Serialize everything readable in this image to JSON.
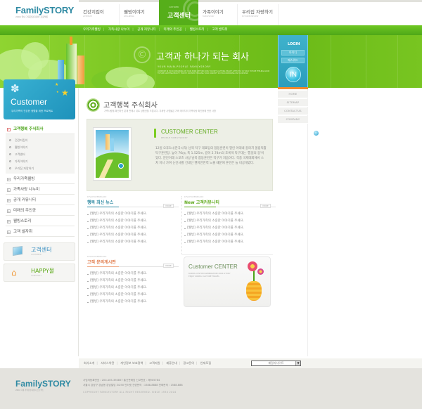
{
  "header": {
    "logo": "FamilySTORY",
    "logo_tagline": "2004 국내 가족건강지킴이 프로젝트",
    "gnb": [
      {
        "label": "건강지킴이",
        "sub": "LIFEHELTH"
      },
      {
        "label": "웰빙이야기",
        "sub": "WELLBEING"
      },
      {
        "label": "고객센터",
        "sub": "CUSTOMER",
        "active": true
      },
      {
        "label": "가족이야기",
        "sub": "FAMILYSTORY"
      },
      {
        "label": "우리집 자랑하기",
        "sub": "MYHOME PREVIEW"
      }
    ]
  },
  "subnav": [
    "우리가족웰빙",
    "가족사랑 나누미",
    "공개 커뮤니티",
    "미래의 주인공",
    "웰빙스토리",
    "고객 발자취"
  ],
  "banner": {
    "title": "고객과 하나가 되는 회사",
    "copyright_glyph": "©",
    "subtitle": "YOUR MAIN-PEOPLE FAMILYSRORY",
    "desc": "COMPOSE IN YOUR DREAMING ON YOUR MIND WE FIND IDEA FOR NET LIGHTING HEALTH LIFESTYLE IN YOUR FUTURE FEELING GOOD FUTURE LIGHTING BEAUTY FOR MY COUNTRY HEALING YOUR CONCEPT IN YOUR DREAMING ON YOUR MIND"
  },
  "login": {
    "title": "LOGIN",
    "id_placeholder": "아이디",
    "pw_placeholder": "패스워드",
    "button": "IN"
  },
  "quick_menu": [
    "HOME",
    "SITEMAP",
    "CONTACTUS",
    "COMPANY"
  ],
  "sidebar": {
    "title": "Customer",
    "subtitle": "우리가족의 건강한 생활을 위한 프로젝트",
    "active_menu": "고객행복 주식회사",
    "sub_items": [
      "건강지킴이",
      "웰빙이야기",
      "고객센터",
      "가족이야기",
      "우리집 자랑하기"
    ],
    "menu": [
      "우리가족웰빙",
      "가족사랑 나누미",
      "공개 커뮤니티",
      "미래의 주인공",
      "웰빙스토리",
      "고객 발자취"
    ],
    "banners": [
      {
        "title": "고객센터",
        "sub": "CUSTOMER"
      },
      {
        "title": "HAPPY몰",
        "sub": "HAPPYMALL"
      }
    ]
  },
  "content": {
    "title": "고객행복 주식회사",
    "desc": "가족사랑을 확인하신 분께 판매시 쉬트 상품권을 드립니다. 자세한 사항들은 가벼 메이지의 가족사랑 확인중에 관한 사항",
    "feature": {
      "title": "CUSTOMER CENTER",
      "subtitle": "PEOPLE FAMILYSRORY",
      "body": "12일 오후5시(한국시각) 남북 탁구 대표팀의 합동훈련이 열린 아데네 갈라치 올림픽홀 탁구훈련장. 높이 76㎝, 폭 1.525m, 길이 2.74m의 초록색 탁구대는 '통일의 장'이었다. 분단이래 스포츠 사상 남북 합동훈련은 탁구가 처음이다. 각종 국제대회에서 스쳐 지나 가며 눈인사를 건네던 핸지만한력 노출 때문에 훈련은 늘 비공개였다."
    },
    "boards": [
      {
        "en": "KEVAPOWERBOARD",
        "title": "행복 최신 뉴스",
        "color": "#2f8aa3",
        "more": "MORE",
        "items": [
          "[웰빙] 우리가족의 소중한 이야기를 주세요.",
          "[웰빙] 우리가족의 소중한 이야기를 주세요.",
          "[웰빙] 우리가족의 소중한 이야기를 주세요.",
          "[웰빙] 우리가족의 소중한 이야기를 주세요.",
          "[웰빙] 우리가족의 소중한 이야기를 주세요."
        ]
      },
      {
        "en": "KEVAPOWERBOARD",
        "title": "New 고객커뮤니티",
        "color": "#5faa1c",
        "more": "MORE",
        "items": [
          "[웰빙] 우리가족의 소중한 이야기를 주세요.",
          "[웰빙] 우리가족의 소중한 이야기를 주세요.",
          "[웰빙] 우리가족의 소중한 이야기를 주세요.",
          "[웰빙] 우리가족의 소중한 이야기를 주세요.",
          "[웰빙] 우리가족의 소중한 이야기를 주세요."
        ]
      },
      {
        "en": "KEVAPOWERBOARD",
        "title": "고객 문의게시판",
        "color": "#e07a4a",
        "more": "MORE",
        "items": [
          "[웰빙] 우리가족의 소중한 이야기를 주세요.",
          "[웰빙] 우리가족의 소중한 이야기를 주세요.",
          "[웰빙] 우리가족의 소중한 이야기를 주세요.",
          "[웰빙] 우리가족의 소중한 이야기를 주세요.",
          "[웰빙] 우리가족의 소중한 이야기를 주세요."
        ]
      }
    ],
    "cc_box": {
      "title": "Customer CENTER",
      "desc1": "KOREA CUSTOM GENERATION 2004 STUDY",
      "desc2": "ENJOY KOREA CLUTURE TRAVEL"
    }
  },
  "footer": {
    "links": [
      "회사소개",
      "서비스약관",
      "개인정보 보호정책",
      "고객지원",
      "제휴안내",
      "광고문의",
      "인재모집"
    ],
    "family_site": "패밀리사이트",
    "logo": "FamilySTORY",
    "logo_tagline": "2004 국내 가족건강지킴이 프로젝트",
    "info1": "사업자등록번호 : 200-405-394857   통신판매업 신고번호 : 제905784",
    "info2": "서울시 강남구 강남동 강남빌딩 34-90   인터넷 관련문의 : 1588-8888 전화문의 : 1588-888",
    "copyright": "COPYRIGHT FAMILYSTORY ALL RIGHT RESERVED. SINCE 1930 2004"
  }
}
